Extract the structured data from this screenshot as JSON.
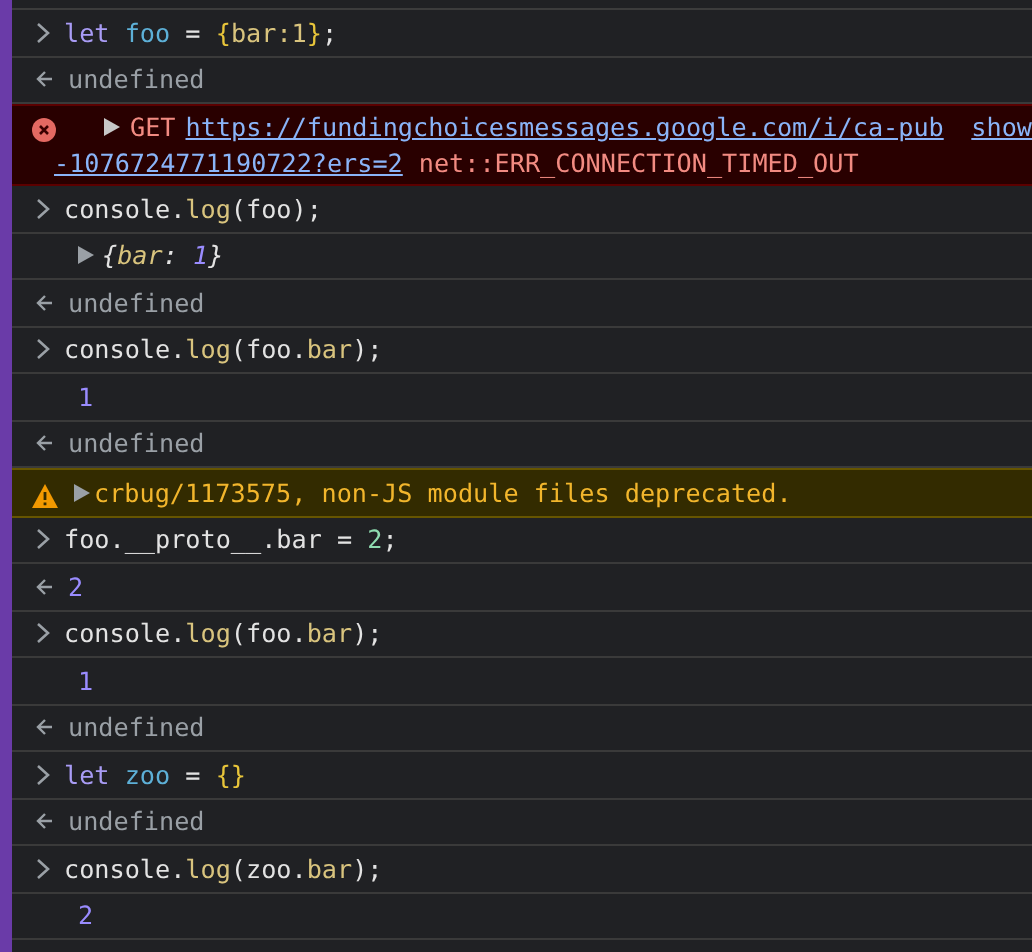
{
  "rows": [
    {
      "kind": "input",
      "tokens": [
        {
          "t": "let",
          "kind": "keyword"
        },
        {
          "t": " foo",
          "kind": "variable"
        },
        {
          "t": " = ",
          "kind": "plain"
        },
        {
          "t": "{",
          "kind": "brace"
        },
        {
          "t": "bar",
          "kind": "property"
        },
        {
          "t": ":1",
          "kind": "property"
        },
        {
          "t": "}",
          "kind": "brace"
        },
        {
          "t": ";",
          "kind": "plain"
        }
      ]
    },
    {
      "kind": "return",
      "tokens": [
        {
          "t": "undefined",
          "kind": "undefined"
        }
      ]
    },
    {
      "kind": "error",
      "expanded": false,
      "method": "GET",
      "url": [
        "https://fundingchoicesmessages.google.com/i/ca-pub",
        "-1076724771190722?ers=2"
      ],
      "message": "net::ERR_CONNECTION_TIMED_OUT",
      "source": "show"
    },
    {
      "kind": "input",
      "tokens": [
        {
          "t": "console.",
          "kind": "plain"
        },
        {
          "t": "log",
          "kind": "function"
        },
        {
          "t": "(foo);",
          "kind": "plain"
        }
      ]
    },
    {
      "kind": "object",
      "expanded": false,
      "tokens": [
        {
          "t": "{",
          "kind": "plain"
        },
        {
          "t": "bar",
          "kind": "property"
        },
        {
          "t": ": ",
          "kind": "plain"
        },
        {
          "t": "1",
          "kind": "value"
        },
        {
          "t": "}",
          "kind": "plain"
        }
      ]
    },
    {
      "kind": "return",
      "tokens": [
        {
          "t": "undefined",
          "kind": "undefined"
        }
      ]
    },
    {
      "kind": "input",
      "tokens": [
        {
          "t": "console.",
          "kind": "plain"
        },
        {
          "t": "log",
          "kind": "function"
        },
        {
          "t": "(foo.",
          "kind": "plain"
        },
        {
          "t": "bar",
          "kind": "property"
        },
        {
          "t": ");",
          "kind": "plain"
        }
      ]
    },
    {
      "kind": "output",
      "tokens": [
        {
          "t": "1",
          "kind": "value"
        }
      ]
    },
    {
      "kind": "return",
      "tokens": [
        {
          "t": "undefined",
          "kind": "undefined"
        }
      ]
    },
    {
      "kind": "warning",
      "expanded": false,
      "message": "crbug/1173575, non-JS module files deprecated."
    },
    {
      "kind": "input",
      "tokens": [
        {
          "t": "foo.__proto__.bar = ",
          "kind": "plain"
        },
        {
          "t": "2",
          "kind": "number"
        },
        {
          "t": ";",
          "kind": "plain"
        }
      ]
    },
    {
      "kind": "return",
      "tokens": [
        {
          "t": "2",
          "kind": "value"
        }
      ]
    },
    {
      "kind": "input",
      "tokens": [
        {
          "t": "console.",
          "kind": "plain"
        },
        {
          "t": "log",
          "kind": "function"
        },
        {
          "t": "(foo.",
          "kind": "plain"
        },
        {
          "t": "bar",
          "kind": "property"
        },
        {
          "t": ");",
          "kind": "plain"
        }
      ]
    },
    {
      "kind": "output",
      "tokens": [
        {
          "t": "1",
          "kind": "value"
        }
      ]
    },
    {
      "kind": "return",
      "tokens": [
        {
          "t": "undefined",
          "kind": "undefined"
        }
      ]
    },
    {
      "kind": "input",
      "tokens": [
        {
          "t": "let",
          "kind": "keyword"
        },
        {
          "t": " zoo",
          "kind": "variable"
        },
        {
          "t": " = ",
          "kind": "plain"
        },
        {
          "t": "{}",
          "kind": "brace"
        }
      ]
    },
    {
      "kind": "return",
      "tokens": [
        {
          "t": "undefined",
          "kind": "undefined"
        }
      ]
    },
    {
      "kind": "input",
      "tokens": [
        {
          "t": "console.",
          "kind": "plain"
        },
        {
          "t": "log",
          "kind": "function"
        },
        {
          "t": "(zoo.",
          "kind": "plain"
        },
        {
          "t": "bar",
          "kind": "property"
        },
        {
          "t": ");",
          "kind": "plain"
        }
      ]
    },
    {
      "kind": "output",
      "tokens": [
        {
          "t": "2",
          "kind": "value"
        }
      ]
    }
  ]
}
